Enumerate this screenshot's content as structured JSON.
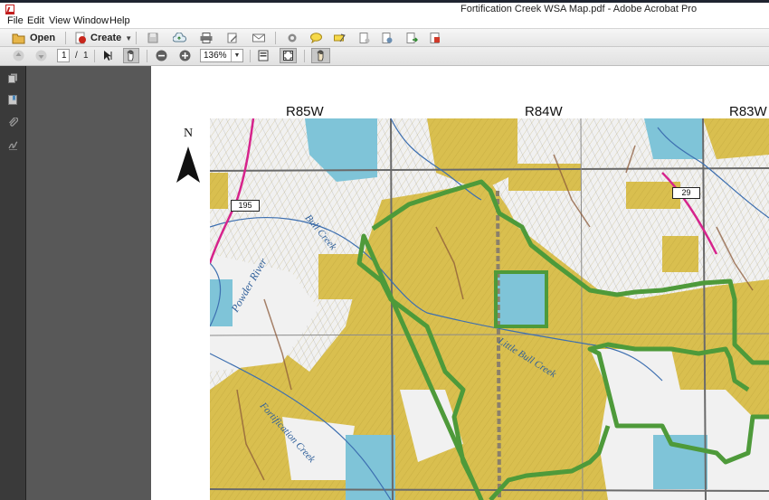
{
  "window": {
    "title": "Fortification Creek WSA Map.pdf - Adobe Acrobat Pro"
  },
  "menu": [
    "File",
    "Edit",
    "View",
    "Window",
    "Help"
  ],
  "toolbar": {
    "open_label": "Open",
    "create_label": "Create",
    "icons": [
      "save-icon",
      "cloud-upload-icon",
      "print-icon",
      "edit-icon",
      "email-icon",
      "gear-icon",
      "comment-icon",
      "highlight-icon",
      "document-icon",
      "document-settings-icon",
      "export-icon",
      "form-icon"
    ]
  },
  "nav": {
    "page_current": "1",
    "page_separator": "/",
    "page_total": "1",
    "zoom": "136%"
  },
  "map": {
    "ranges": [
      "R85W",
      "R84W",
      "R83W"
    ],
    "north_label": "N",
    "highway_labels": [
      "195",
      "29"
    ],
    "creek_labels": [
      "Powder River",
      "Bull Creek",
      "Little Bull Creek",
      "Fortification Creek"
    ],
    "colors": {
      "wsa_boundary": "#4e9a3a",
      "federal_land": "#d9bf4f",
      "state_land": "#7fc4d8",
      "road": "#d6238c",
      "grid": "#6a6a6a"
    }
  }
}
